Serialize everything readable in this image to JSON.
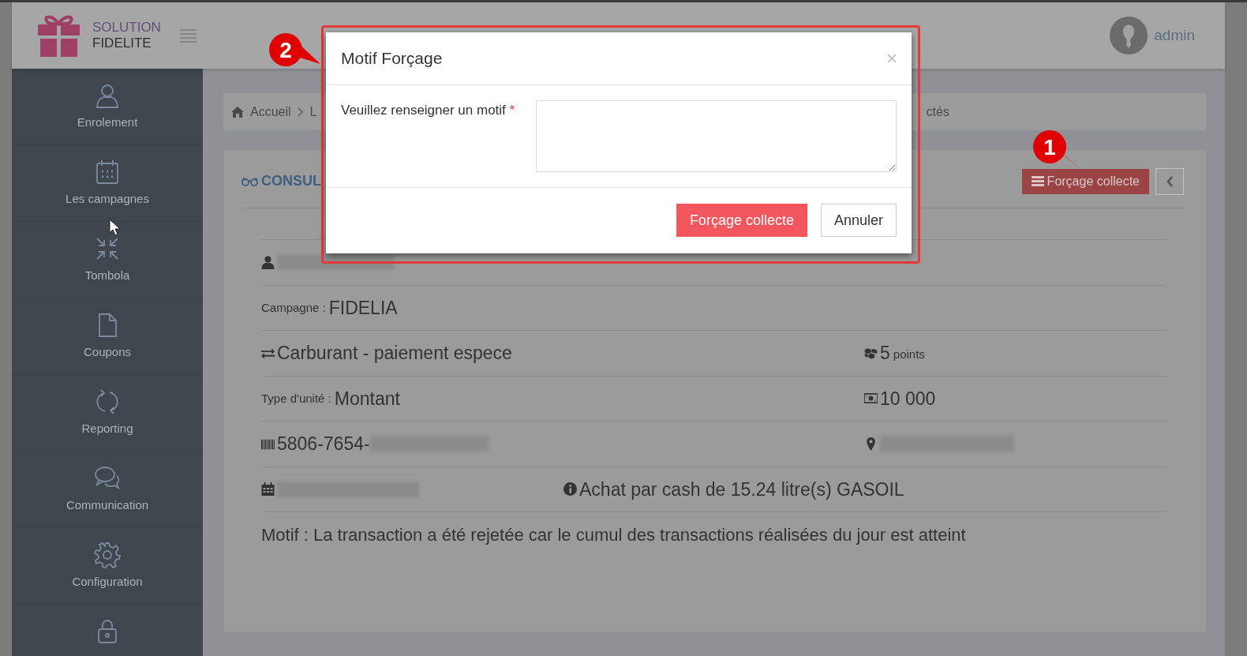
{
  "header": {
    "brand": [
      "SOLUTION",
      "FIDELITE"
    ],
    "user": "admin"
  },
  "sidebar": {
    "items": [
      {
        "label": "Enrolement",
        "kind": "user"
      },
      {
        "label": "Les campagnes",
        "kind": "calendar"
      },
      {
        "label": "Tombola",
        "kind": "compress"
      },
      {
        "label": "Coupons",
        "kind": "file"
      },
      {
        "label": "Reporting",
        "kind": "refresh"
      },
      {
        "label": "Communication",
        "kind": "chat"
      },
      {
        "label": "Configuration",
        "kind": "gear"
      },
      {
        "kind": "lock"
      }
    ]
  },
  "breadcrumb": {
    "items": [
      "Accueil",
      "L"
    ],
    "tail": "ctés"
  },
  "panel": {
    "title": "CONSUL",
    "actions": [
      {
        "label": "Forçage collecte",
        "kind": "primary"
      },
      {
        "kind": "back"
      }
    ]
  },
  "details": [
    {
      "cells": [
        {
          "kind": "person",
          "redacted": true
        }
      ]
    },
    {
      "cells": [
        {
          "kind": "labeled",
          "label": "Campagne :",
          "value": "FIDELIA"
        }
      ]
    },
    {
      "cells": [
        {
          "kind": "transfer",
          "value": "Carburant - paiement espece"
        },
        {
          "kind": "cubes",
          "value": "5",
          "unit": "points"
        }
      ]
    },
    {
      "cells": [
        {
          "kind": "labeled",
          "label": "Type d'unité :",
          "value": "Montant"
        },
        {
          "kind": "money",
          "value": "10 000"
        }
      ]
    },
    {
      "cells": [
        {
          "kind": "barcode",
          "value": "5806-7654-",
          "redacted": true
        },
        {
          "kind": "pin",
          "redacted": true
        }
      ]
    },
    {
      "cells": [
        {
          "kind": "calendar",
          "redacted": true
        },
        {
          "kind": "info",
          "value": "Achat par cash de 15.24 litre(s) GASOIL"
        }
      ]
    },
    {
      "cells": [
        {
          "kind": "plain",
          "value": "Motif : La transaction a été rejetée car le cumul des transactions réalisées du jour est atteint"
        }
      ]
    }
  ],
  "modal": {
    "title": "Motif Forçage",
    "close": "×",
    "field": {
      "label": "Veuillez renseigner un motif",
      "required": true,
      "required_mark": "*"
    },
    "buttons": [
      {
        "label": "Forçage collecte",
        "kind": "primary"
      },
      {
        "label": "Annuler",
        "kind": "secondary"
      }
    ]
  },
  "callouts": [
    {
      "number": "1"
    },
    {
      "number": "2"
    }
  ]
}
